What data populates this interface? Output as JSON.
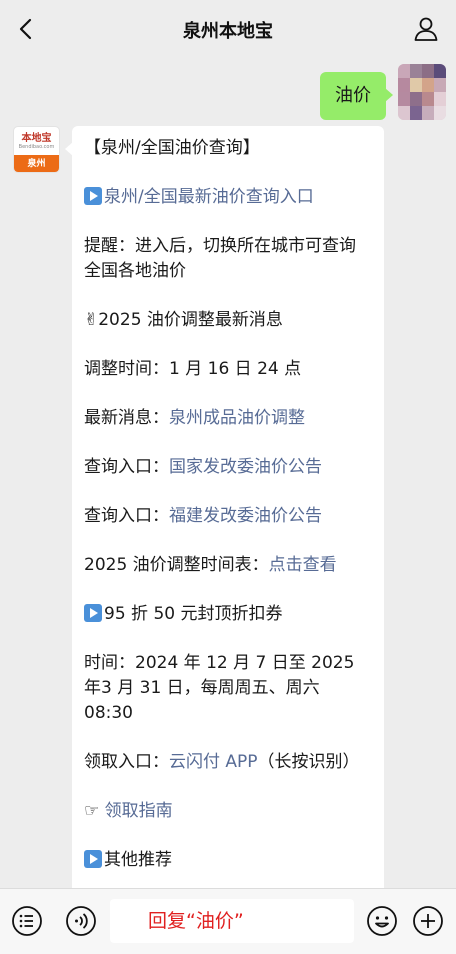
{
  "header": {
    "title": "泉州本地宝",
    "back_icon": "chevron-left-icon",
    "profile_icon": "person-icon"
  },
  "outgoing_message": {
    "text": "油价"
  },
  "bot": {
    "avatar_logo": "本地宝",
    "avatar_site": "Bendibao.com",
    "avatar_city": "泉州"
  },
  "message": {
    "title": "【泉州/全国油价查询】",
    "entry_link": "泉州/全国最新油价查询入口",
    "reminder": "提醒：进入后，切换所在城市可查询全国各地油价",
    "news_heading": "✌2025 油价调整最新消息",
    "adjust_time": "调整时间：1 月 16 日 24 点",
    "latest_label": "最新消息：",
    "latest_link": "泉州成品油价调整",
    "query1_label": "查询入口：",
    "query1_link": "国家发改委油价公告",
    "query2_label": "查询入口：",
    "query2_link": "福建发改委油价公告",
    "schedule_label": "2025 油价调整时间表：",
    "schedule_link": "点击查看",
    "coupon_title": "95 折 50 元封顶折扣券",
    "coupon_time": "时间：2024 年 12 月 7 日至 2025 年3 月 31 日，每周周五、周六 08:30",
    "claim_label": "领取入口：",
    "claim_link": "云闪付 APP",
    "claim_note": "（长按识别）",
    "guide_icon": "☞",
    "guide_link": "领取指南",
    "other": "其他推荐"
  },
  "bottombar": {
    "reply_text": "回复“油价”",
    "menu_icon": "list-icon",
    "voice_icon": "voice-icon",
    "emoji_icon": "emoji-icon",
    "plus_icon": "plus-icon"
  },
  "colors": {
    "background": "#ededed",
    "outgoing_bubble": "#95ec69",
    "link": "#576b95",
    "reply_text": "#e02020"
  }
}
